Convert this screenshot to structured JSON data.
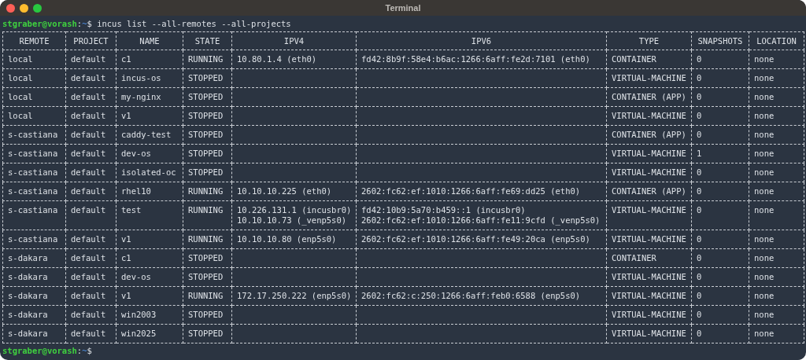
{
  "window": {
    "title": "Terminal"
  },
  "command_line": {
    "user_host": "stgraber@vorash",
    "separator": ":",
    "path": "~",
    "symbol": "$",
    "command": "incus list --all-remotes --all-projects"
  },
  "table": {
    "columns": [
      "REMOTE",
      "PROJECT",
      "NAME",
      "STATE",
      "IPV4",
      "IPV6",
      "TYPE",
      "SNAPSHOTS",
      "LOCATION"
    ],
    "rows": [
      [
        [
          "local"
        ],
        [
          "default"
        ],
        [
          "c1"
        ],
        [
          "RUNNING"
        ],
        [
          "10.80.1.4 (eth0)"
        ],
        [
          "fd42:8b9f:58e4:b6ac:1266:6aff:fe2d:7101 (eth0)"
        ],
        [
          "CONTAINER"
        ],
        [
          "0"
        ],
        [
          "none"
        ]
      ],
      [
        [
          "local"
        ],
        [
          "default"
        ],
        [
          "incus-os"
        ],
        [
          "STOPPED"
        ],
        [],
        [],
        [
          "VIRTUAL-MACHINE"
        ],
        [
          "0"
        ],
        [
          "none"
        ]
      ],
      [
        [
          "local"
        ],
        [
          "default"
        ],
        [
          "my-nginx"
        ],
        [
          "STOPPED"
        ],
        [],
        [],
        [
          "CONTAINER (APP)"
        ],
        [
          "0"
        ],
        [
          "none"
        ]
      ],
      [
        [
          "local"
        ],
        [
          "default"
        ],
        [
          "v1"
        ],
        [
          "STOPPED"
        ],
        [],
        [],
        [
          "VIRTUAL-MACHINE"
        ],
        [
          "0"
        ],
        [
          "none"
        ]
      ],
      [
        [
          "s-castiana"
        ],
        [
          "default"
        ],
        [
          "caddy-test"
        ],
        [
          "STOPPED"
        ],
        [],
        [],
        [
          "CONTAINER (APP)"
        ],
        [
          "0"
        ],
        [
          "none"
        ]
      ],
      [
        [
          "s-castiana"
        ],
        [
          "default"
        ],
        [
          "dev-os"
        ],
        [
          "STOPPED"
        ],
        [],
        [],
        [
          "VIRTUAL-MACHINE"
        ],
        [
          "1"
        ],
        [
          "none"
        ]
      ],
      [
        [
          "s-castiana"
        ],
        [
          "default"
        ],
        [
          "isolated-oc"
        ],
        [
          "STOPPED"
        ],
        [],
        [],
        [
          "VIRTUAL-MACHINE"
        ],
        [
          "0"
        ],
        [
          "none"
        ]
      ],
      [
        [
          "s-castiana"
        ],
        [
          "default"
        ],
        [
          "rhel10"
        ],
        [
          "RUNNING"
        ],
        [
          "10.10.10.225 (eth0)"
        ],
        [
          "2602:fc62:ef:1010:1266:6aff:fe69:dd25 (eth0)"
        ],
        [
          "CONTAINER (APP)"
        ],
        [
          "0"
        ],
        [
          "none"
        ]
      ],
      [
        [
          "s-castiana"
        ],
        [
          "default"
        ],
        [
          "test"
        ],
        [
          "RUNNING"
        ],
        [
          "10.226.131.1 (incusbr0)",
          "10.10.10.73 (_venp5s0)"
        ],
        [
          "fd42:10b9:5a70:b459::1 (incusbr0)",
          "2602:fc62:ef:1010:1266:6aff:fe11:9cfd (_venp5s0)"
        ],
        [
          "VIRTUAL-MACHINE"
        ],
        [
          "0"
        ],
        [
          "none"
        ]
      ],
      [
        [
          "s-castiana"
        ],
        [
          "default"
        ],
        [
          "v1"
        ],
        [
          "RUNNING"
        ],
        [
          "10.10.10.80 (enp5s0)"
        ],
        [
          "2602:fc62:ef:1010:1266:6aff:fe49:20ca (enp5s0)"
        ],
        [
          "VIRTUAL-MACHINE"
        ],
        [
          "0"
        ],
        [
          "none"
        ]
      ],
      [
        [
          "s-dakara"
        ],
        [
          "default"
        ],
        [
          "c1"
        ],
        [
          "STOPPED"
        ],
        [],
        [],
        [
          "CONTAINER"
        ],
        [
          "0"
        ],
        [
          "none"
        ]
      ],
      [
        [
          "s-dakara"
        ],
        [
          "default"
        ],
        [
          "dev-os"
        ],
        [
          "STOPPED"
        ],
        [],
        [],
        [
          "VIRTUAL-MACHINE"
        ],
        [
          "0"
        ],
        [
          "none"
        ]
      ],
      [
        [
          "s-dakara"
        ],
        [
          "default"
        ],
        [
          "v1"
        ],
        [
          "RUNNING"
        ],
        [
          "172.17.250.222 (enp5s0)"
        ],
        [
          "2602:fc62:c:250:1266:6aff:feb0:6588 (enp5s0)"
        ],
        [
          "VIRTUAL-MACHINE"
        ],
        [
          "0"
        ],
        [
          "none"
        ]
      ],
      [
        [
          "s-dakara"
        ],
        [
          "default"
        ],
        [
          "win2003"
        ],
        [
          "STOPPED"
        ],
        [],
        [],
        [
          "VIRTUAL-MACHINE"
        ],
        [
          "0"
        ],
        [
          "none"
        ]
      ],
      [
        [
          "s-dakara"
        ],
        [
          "default"
        ],
        [
          "win2025"
        ],
        [
          "STOPPED"
        ],
        [],
        [],
        [
          "VIRTUAL-MACHINE"
        ],
        [
          "0"
        ],
        [
          "none"
        ]
      ]
    ]
  },
  "prompt": {
    "user_host": "stgraber@vorash",
    "separator": ":",
    "path": "~",
    "symbol": "$"
  }
}
